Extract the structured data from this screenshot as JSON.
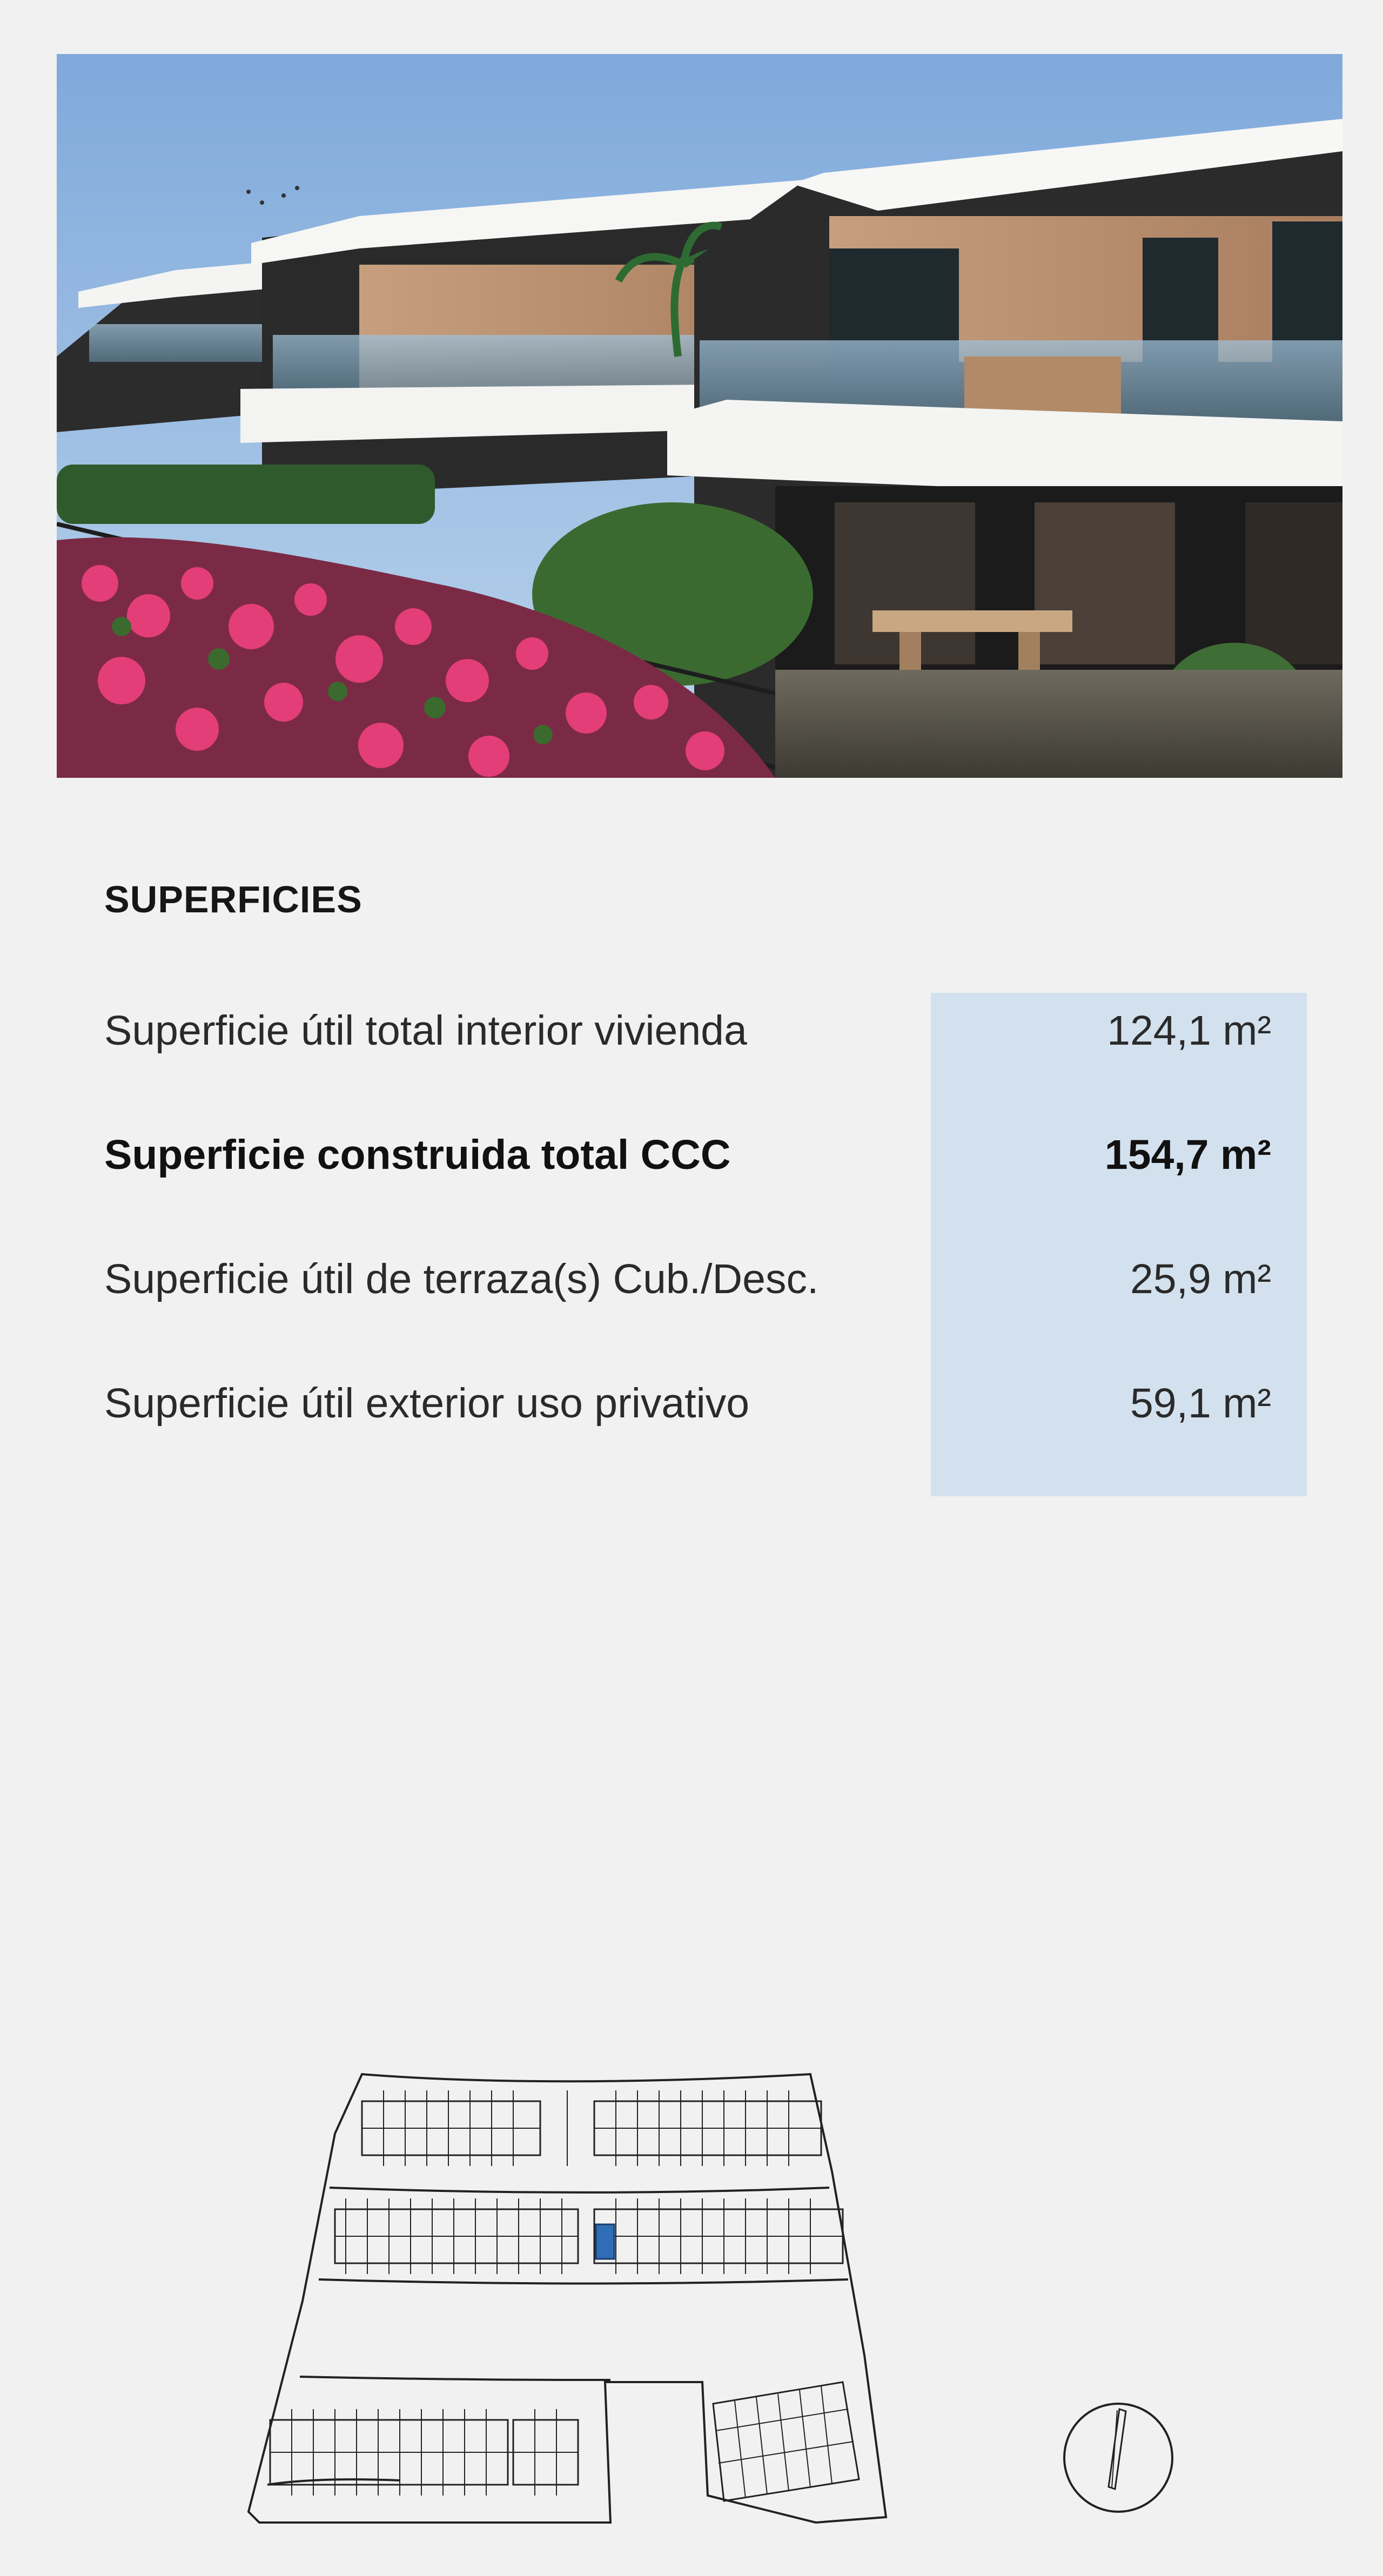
{
  "section": {
    "title": "SUPERFICIES"
  },
  "surfaces": [
    {
      "label": "Superficie útil total interior vivienda",
      "value": "124,1 m²",
      "highlight": false
    },
    {
      "label": "Superficie construida total CCC",
      "value": "154,7 m²",
      "highlight": true
    },
    {
      "label": "Superficie útil de terraza(s) Cub./Desc.",
      "value": "25,9 m²",
      "highlight": false
    },
    {
      "label": "Superficie útil exterior uso privativo",
      "value": "59,1 m²",
      "highlight": false
    }
  ],
  "colors": {
    "background": "#f1f1f1",
    "value_panel": "#d3e1ee",
    "selected_unit": "#2f6db5",
    "plan_line": "#222222"
  },
  "site_plan": {
    "selected_unit_highlighted": true
  }
}
